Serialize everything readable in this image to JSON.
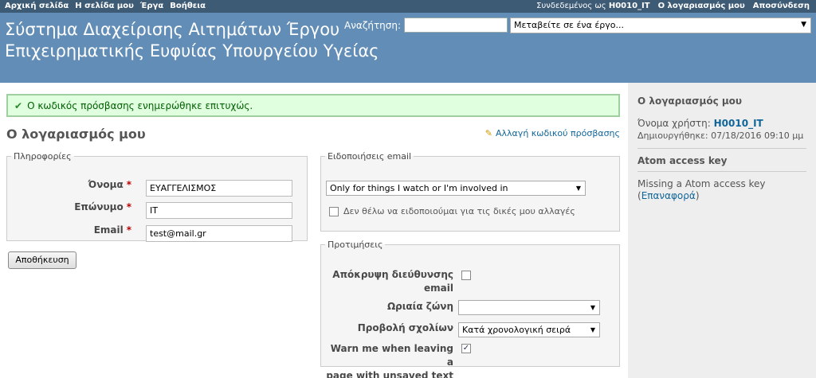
{
  "top_menu": {
    "items": [
      "Αρχική σελίδα",
      "Η σελίδα μου",
      "Έργα",
      "Βοήθεια"
    ],
    "logged_prefix": "Συνδεδεμένος ως",
    "user": "H0010_IT",
    "account": "Ο λογαριασμός μου",
    "logout": "Αποσύνδεση"
  },
  "header": {
    "title_line1": "Σύστημα Διαχείρισης Αιτημάτων Έργου",
    "title_line2": "Επιχειρηματικής Ευφυίας Υπουργείου Υγείας",
    "search_label": "Αναζήτηση:",
    "search_value": "",
    "project_jump": "Μεταβείτε σε ένα έργο..."
  },
  "flash": "Ο κωδικός πρόσβασης ενημερώθηκε επιτυχώς.",
  "page_title": "Ο λογαριασμός μου",
  "change_password": "Αλλαγή κωδικού πρόσβασης",
  "info": {
    "legend": "Πληροφορίες",
    "first_name_label": "Όνομα",
    "first_name": "ΕΥΑΓΓΕΛΙΣΜΟΣ",
    "last_name_label": "Επώνυμο",
    "last_name": "IT",
    "email_label": "Email",
    "email": "test@mail.gr",
    "required_mark": "*"
  },
  "save_button": "Αποθήκευση",
  "mail": {
    "legend": "Ειδοποιήσεις email",
    "option": "Only for things I watch or I'm involved in",
    "no_self_label": "Δεν θέλω να ειδοποιούμαι για τις δικές μου αλλαγές",
    "no_self_checked": false
  },
  "prefs": {
    "legend": "Προτιμήσεις",
    "hide_mail_label_1": "Απόκρυψη διεύθυνσης",
    "hide_mail_label_2": "email",
    "hide_mail_checked": false,
    "timezone_label": "Ωριαία ζώνη",
    "timezone_value": "",
    "comments_label": "Προβολή σχολίων",
    "comments_value": "Κατά χρονολογική σειρά",
    "warn_label_1": "Warn me when leaving a",
    "warn_label_2": "page with unsaved text",
    "warn_checked": true
  },
  "sidebar": {
    "title": "Ο λογαριασμός μου",
    "login_label": "Όνομα χρήστη:",
    "login": "H0010_IT",
    "created_label": "Δημιουργήθηκε:",
    "created": "07/18/2016 09:10 μμ",
    "atom_title": "Atom access key",
    "atom_missing": "Missing a Atom access key",
    "atom_reset": "Επαναφορά"
  }
}
